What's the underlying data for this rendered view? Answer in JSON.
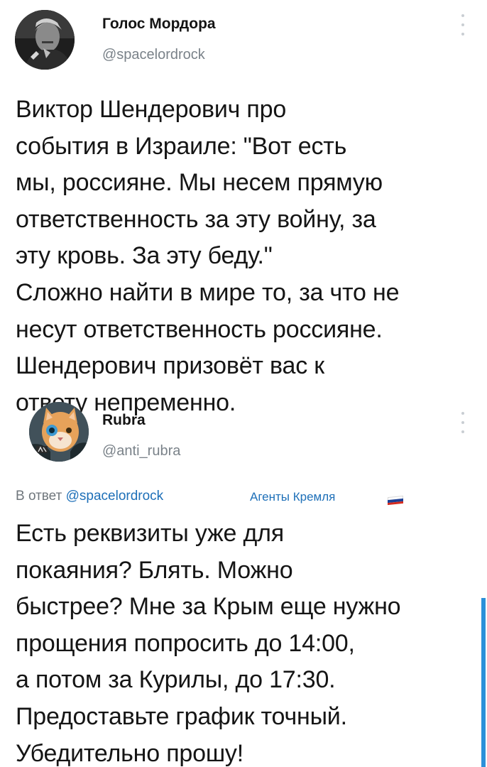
{
  "tweet1": {
    "author_name": "Голос Мордора",
    "author_handle": "@spacelordrock",
    "text_lines": [
      "Виктор Шендерович про",
      "события в Израиле: \"Вот есть",
      "мы, россияне. Мы несем прямую",
      "ответственность за эту войну, за",
      "эту кровь. За эту беду.\"",
      "Сложно найти в мире то, за что не",
      "несут ответственность россияне.",
      "Шендерович призовёт вас к",
      "ответу непременно."
    ]
  },
  "tweet2": {
    "author_name": "Rubra",
    "author_handle": "@anti_rubra",
    "reply_prefix": "В ответ",
    "reply_to": "@spacelordrock",
    "badge_label": "Агенты Кремля",
    "badge_flag_colors": [
      "#ffffff",
      "#1c3f94",
      "#d52b1e"
    ],
    "text_lines": [
      "Есть реквизиты уже для",
      "покаяния? Блять. Можно",
      "быстрее? Мне за Крым еще нужно",
      "прощения попросить до 14:00,",
      "а потом за Курилы, до 17:30.",
      "Предоставьте график точный.",
      "Убедительно прошу!"
    ]
  },
  "colors": {
    "link": "#1d6fb8",
    "secondary_text": "#7a8289",
    "scrollbar": "#2b90d9"
  }
}
